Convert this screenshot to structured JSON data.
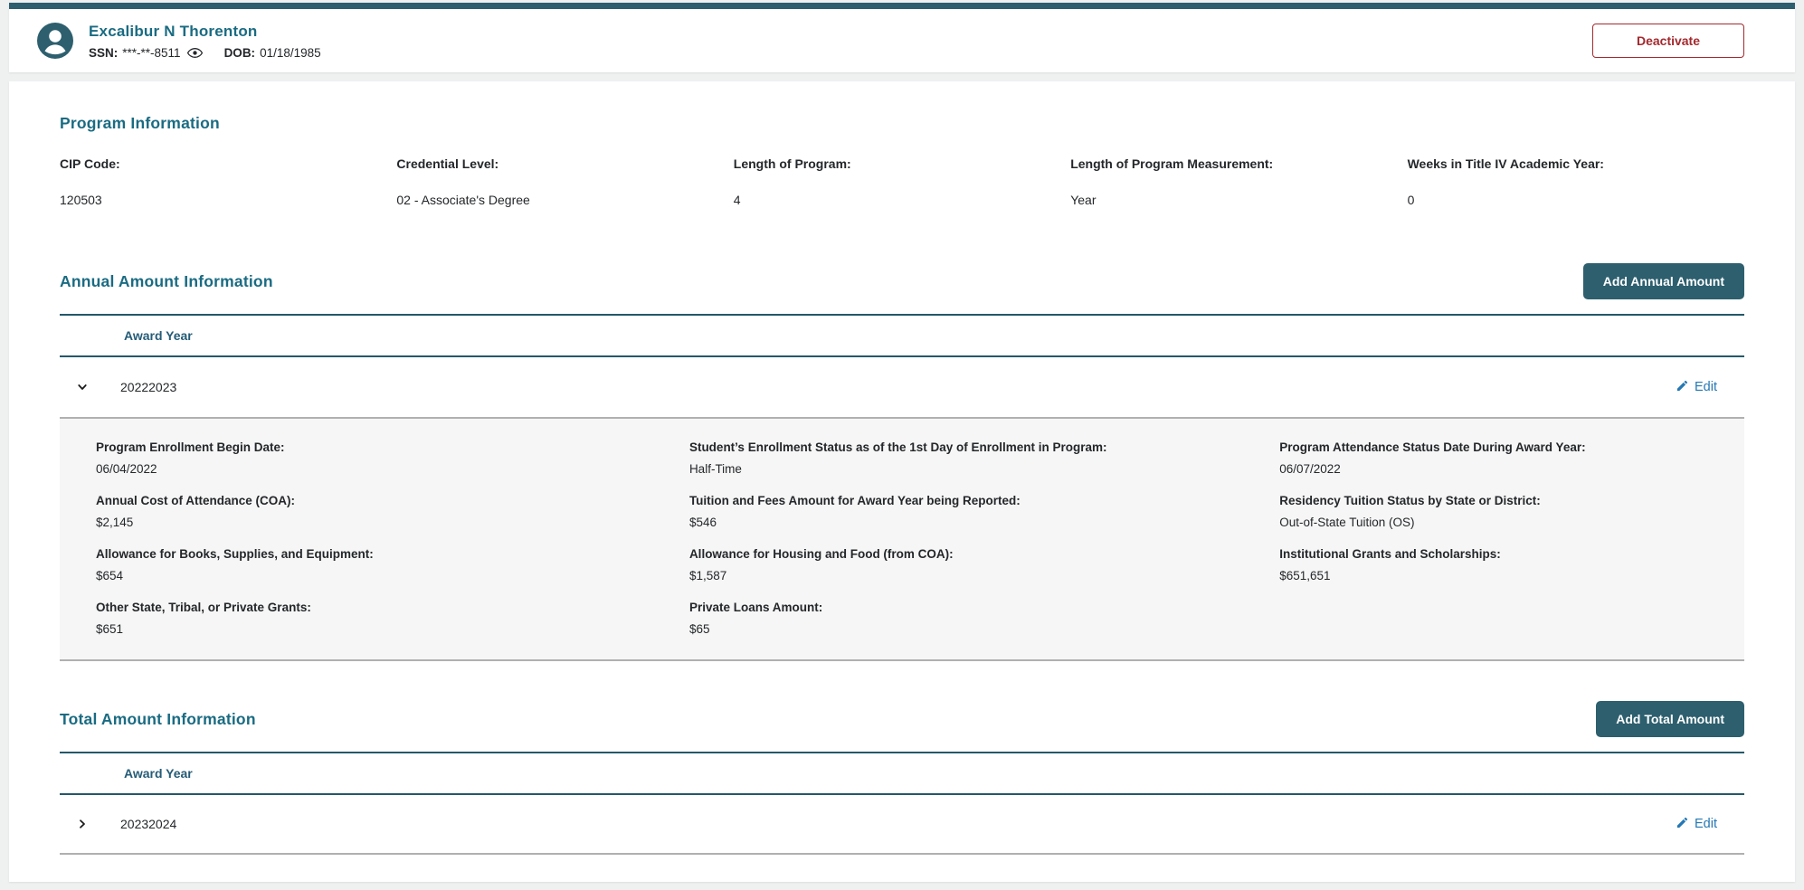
{
  "colors": {
    "accent_teal": "#2d5f6e",
    "heading_teal": "#1a6b82",
    "table_border_teal": "#24586a",
    "link_blue": "#2478b5",
    "danger_red": "#a3292e",
    "panel_gray": "#f6f6f6"
  },
  "header": {
    "name": "Excalibur N Thorenton",
    "ssn_label": "SSN:",
    "ssn_value": "***-**-8511",
    "dob_label": "DOB:",
    "dob_value": "01/18/1985",
    "deactivate_label": "Deactivate"
  },
  "program_info": {
    "title": "Program Information",
    "fields": [
      {
        "label": "CIP Code:",
        "value": "120503"
      },
      {
        "label": "Credential Level:",
        "value": "02 - Associate's Degree"
      },
      {
        "label": "Length of Program:",
        "value": "4"
      },
      {
        "label": "Length of Program Measurement:",
        "value": "Year"
      },
      {
        "label": "Weeks in Title IV Academic Year:",
        "value": "0"
      }
    ]
  },
  "annual_amounts": {
    "title": "Annual Amount Information",
    "add_button_label": "Add Annual Amount",
    "column_header": "Award Year",
    "row": {
      "award_year": "20222023",
      "edit_label": "Edit",
      "expanded": true
    },
    "details": [
      {
        "label": "Program Enrollment Begin Date:",
        "value": "06/04/2022"
      },
      {
        "label": "Student’s Enrollment Status as of the 1st Day of Enrollment in Program:",
        "value": "Half-Time"
      },
      {
        "label": "Program Attendance Status Date During Award Year:",
        "value": "06/07/2022"
      },
      {
        "label": "Annual Cost of Attendance (COA):",
        "value": "$2,145"
      },
      {
        "label": "Tuition and Fees Amount for Award Year being Reported:",
        "value": "$546"
      },
      {
        "label": "Residency Tuition Status by State or District:",
        "value": "Out-of-State Tuition (OS)"
      },
      {
        "label": "Allowance for Books, Supplies, and Equipment:",
        "value": "$654"
      },
      {
        "label": "Allowance for Housing and Food (from COA):",
        "value": "$1,587"
      },
      {
        "label": "Institutional Grants and Scholarships:",
        "value": "$651,651"
      },
      {
        "label": "Other State, Tribal, or Private Grants:",
        "value": "$651"
      },
      {
        "label": "Private Loans Amount:",
        "value": "$65"
      }
    ]
  },
  "total_amounts": {
    "title": "Total Amount Information",
    "add_button_label": "Add Total Amount",
    "column_header": "Award Year",
    "row": {
      "award_year": "20232024",
      "edit_label": "Edit",
      "expanded": false
    }
  }
}
